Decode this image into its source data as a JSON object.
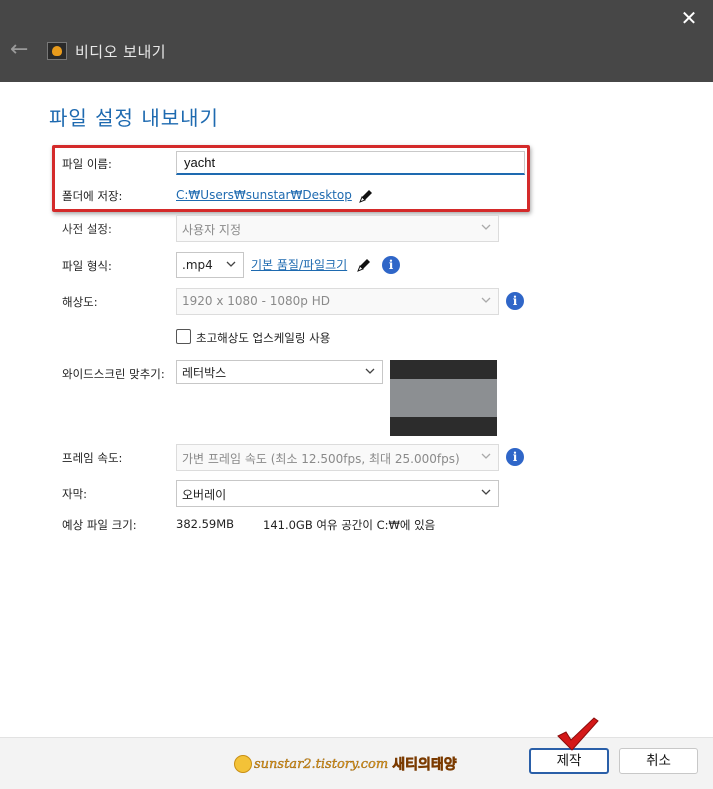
{
  "window": {
    "title": "비디오 보내기",
    "close_icon": "close-icon",
    "back_icon": "arrow-left-icon"
  },
  "section_title": "파일 설정 내보내기",
  "form": {
    "file_name": {
      "label": "파일 이름:",
      "value": "yacht"
    },
    "save_folder": {
      "label": "폴더에 저장:",
      "value": "C:₩Users₩sunstar₩Desktop"
    },
    "preset": {
      "label": "사전 설정:",
      "value": "사용자 지정"
    },
    "file_format": {
      "label": "파일 형식:",
      "value": ".mp4",
      "quality_link": "기본 품질/파일크기"
    },
    "resolution": {
      "label": "해상도:",
      "value": "1920 x 1080 - 1080p HD"
    },
    "upscaling": {
      "label": "초고해상도 업스케일링 사용",
      "checked": false
    },
    "widescreen": {
      "label": "와이드스크린 맞추기:",
      "value": "레터박스"
    },
    "frame_rate": {
      "label": "프레임 속도:",
      "value": "가변 프레임 속도 (최소 12.500fps, 최대 25.000fps)"
    },
    "subtitles": {
      "label": "자막:",
      "value": "오버레이"
    },
    "estimated_size": {
      "label": "예상 파일 크기:",
      "value": "382.59MB",
      "free_space": "141.0GB 여유 공간이 C:₩에 있음"
    }
  },
  "footer": {
    "produce_label": "제작",
    "cancel_label": "취소",
    "watermark_url": "sunstar2.tistory.com",
    "watermark_name": "새티의태양"
  },
  "colors": {
    "titlebar": "#474747",
    "accent": "#1e6ab0",
    "highlight": "#d42a2a",
    "info": "#2f66c8"
  }
}
